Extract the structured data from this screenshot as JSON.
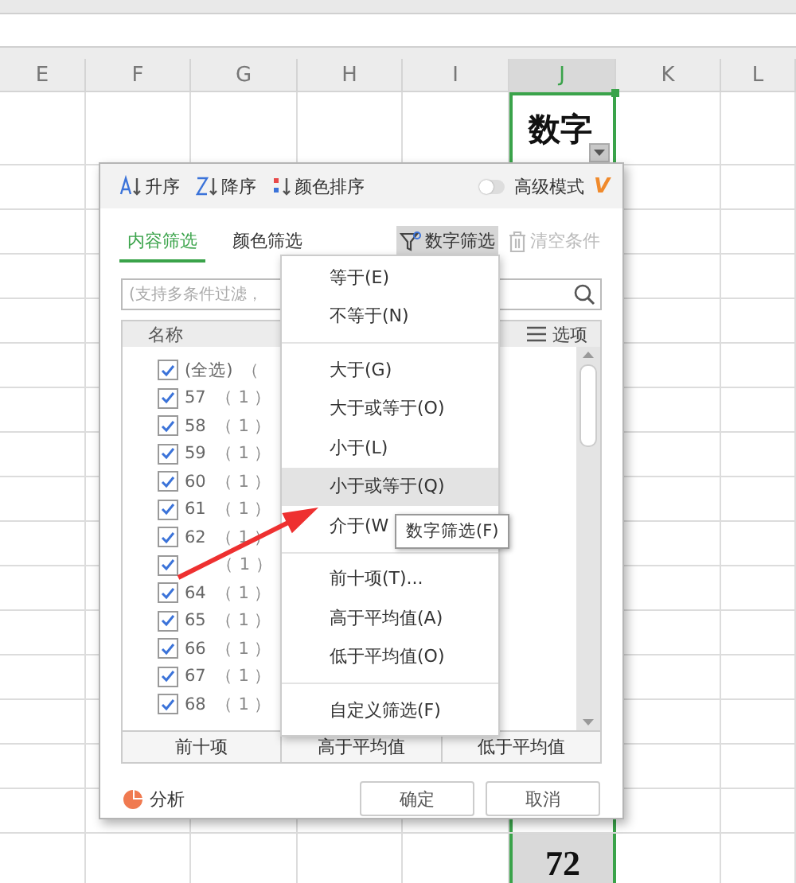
{
  "spreadsheet": {
    "columns": [
      {
        "label": "E",
        "selected": false
      },
      {
        "label": "F",
        "selected": false
      },
      {
        "label": "G",
        "selected": false
      },
      {
        "label": "H",
        "selected": false
      },
      {
        "label": "I",
        "selected": false
      },
      {
        "label": "J",
        "selected": true
      },
      {
        "label": "K",
        "selected": false
      },
      {
        "label": "L",
        "selected": false
      }
    ],
    "cells": [
      {
        "kind": "header",
        "text": "数字"
      },
      {
        "kind": "value",
        "text": "72"
      }
    ]
  },
  "filter_dialog": {
    "toolbar": {
      "sort_buttons": [
        {
          "kind": "asc",
          "label": "升序"
        },
        {
          "kind": "desc",
          "label": "降序"
        },
        {
          "kind": "color",
          "label": "颜色排序"
        }
      ],
      "advanced_mode": {
        "label": "高级模式",
        "on": false
      },
      "badge": "V"
    },
    "tabs": [
      {
        "label": "内容筛选",
        "selected": true
      },
      {
        "label": "颜色筛选",
        "selected": false
      }
    ],
    "actions": [
      {
        "kind": "filter",
        "label": "数字筛选",
        "pressed": true,
        "disabled": false
      },
      {
        "kind": "clear",
        "label": "清空条件",
        "pressed": false,
        "disabled": true
      }
    ],
    "search": {
      "placeholder": "(支持多条件过滤，"
    },
    "list": {
      "header": "名称",
      "options_label": "选项",
      "items": [
        {
          "name": "(全选)",
          "count": "（",
          "checked": true
        },
        {
          "name": "57",
          "count": "（ 1 ）",
          "checked": true
        },
        {
          "name": "58",
          "count": "（ 1 ）",
          "checked": true
        },
        {
          "name": "59",
          "count": "（ 1 ）",
          "checked": true
        },
        {
          "name": "60",
          "count": "（ 1 ）",
          "checked": true
        },
        {
          "name": "61",
          "count": "（ 1 ）",
          "checked": true
        },
        {
          "name": "62",
          "count": "（ 1 ）",
          "checked": true
        },
        {
          "count": "（ 1 ）",
          "checked": true
        },
        {
          "name": "64",
          "count": "（ 1 ）",
          "checked": true
        },
        {
          "name": "65",
          "count": "（ 1 ）",
          "checked": true
        },
        {
          "name": "66",
          "count": "（ 1 ）",
          "checked": true
        },
        {
          "name": "67",
          "count": "（ 1 ）",
          "checked": true
        },
        {
          "name": "68",
          "count": "（ 1 ）",
          "checked": true
        }
      ]
    },
    "quick_buttons": [
      "前十项",
      "高于平均值",
      "低于平均值"
    ],
    "analysis": "分析",
    "buttons": [
      "确定",
      "取消"
    ]
  },
  "number_filter_menu": {
    "groups": [
      [
        {
          "label": "等于(E)",
          "selected": false
        },
        {
          "label": "不等于(N)",
          "selected": false
        }
      ],
      [
        {
          "label": "大于(G)",
          "selected": false
        },
        {
          "label": "大于或等于(O)",
          "selected": false
        },
        {
          "label": "小于(L)",
          "selected": false
        },
        {
          "label": "小于或等于(Q)",
          "selected": true
        },
        {
          "label": "介于(W",
          "selected": false
        }
      ],
      [
        {
          "label": "前十项(T)...",
          "selected": false
        },
        {
          "label": "高于平均值(A)",
          "selected": false
        },
        {
          "label": "低于平均值(O)",
          "selected": false
        }
      ],
      [
        {
          "label": "自定义筛选(F)",
          "selected": false
        }
      ]
    ]
  },
  "tooltip": "数字筛选(F)"
}
